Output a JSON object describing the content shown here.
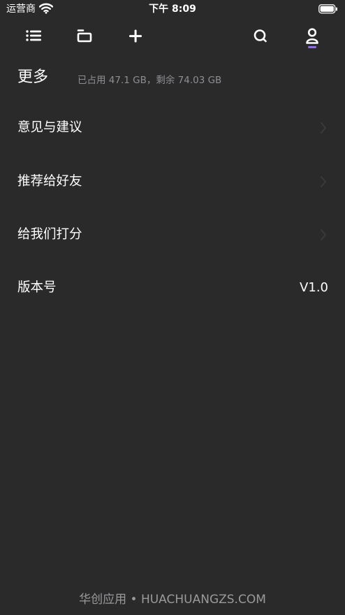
{
  "status_bar": {
    "carrier": "运营商",
    "time": "下午 8:09",
    "wifi_icon": "wifi-icon",
    "battery_icon": "battery-icon"
  },
  "toolbar": {
    "icons": [
      "list-icon",
      "folder-icon",
      "plus-icon",
      "search-icon",
      "user-icon"
    ],
    "active": "user-icon",
    "accent_color": "#8b6cf2"
  },
  "header": {
    "title": "更多",
    "storage": "已占用 47.1 GB，剩余 74.03 GB"
  },
  "menu": {
    "feedback": "意见与建议",
    "recommend": "推荐给好友",
    "rate": "给我们打分",
    "version_label": "版本号",
    "version_value": "V1.0"
  },
  "watermark": "华创应用 • HUACHUANGZS.COM",
  "colors": {
    "background": "#2a2a2b",
    "secondary_text": "#8e8e92"
  }
}
